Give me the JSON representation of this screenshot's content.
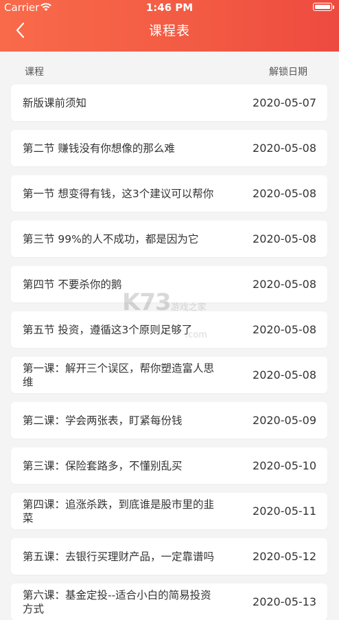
{
  "status": {
    "carrier": "Carrier",
    "time": "1:46 PM"
  },
  "header": {
    "title": "课程表",
    "back_icon": "chevron-left-icon"
  },
  "columns": {
    "course": "课程",
    "date": "解锁日期"
  },
  "courses": [
    {
      "title": "新版课前须知",
      "date": "2020-05-07"
    },
    {
      "title": "第二节 赚钱没有你想像的那么难",
      "date": "2020-05-08"
    },
    {
      "title": "第一节 想变得有钱，这3个建议可以帮你",
      "date": "2020-05-08"
    },
    {
      "title": "第三节 99%的人不成功，都是因为它",
      "date": "2020-05-08"
    },
    {
      "title": "第四节 不要杀你的鹅",
      "date": "2020-05-08"
    },
    {
      "title": "第五节 投资，遵循这3个原则足够了",
      "date": "2020-05-08"
    },
    {
      "title": "第一课：解开三个误区，帮你塑造富人思维",
      "date": "2020-05-08"
    },
    {
      "title": "第二课：学会两张表，盯紧每份钱",
      "date": "2020-05-09"
    },
    {
      "title": "第三课：保险套路多，不懂别乱买",
      "date": "2020-05-10"
    },
    {
      "title": "第四课：追涨杀跌，到底谁是股市里的韭菜",
      "date": "2020-05-11"
    },
    {
      "title": "第五课：去银行买理财产品，一定靠谱吗",
      "date": "2020-05-12"
    },
    {
      "title": "第六课：基金定投--适合小白的简易投资方式",
      "date": "2020-05-13"
    }
  ],
  "watermark": {
    "main": "K73",
    "sub": "游戏之家",
    "domain": ".com"
  },
  "colors": {
    "header_start": "#f96a4a",
    "header_end": "#ee4a3f",
    "background": "#f4f4f5"
  }
}
